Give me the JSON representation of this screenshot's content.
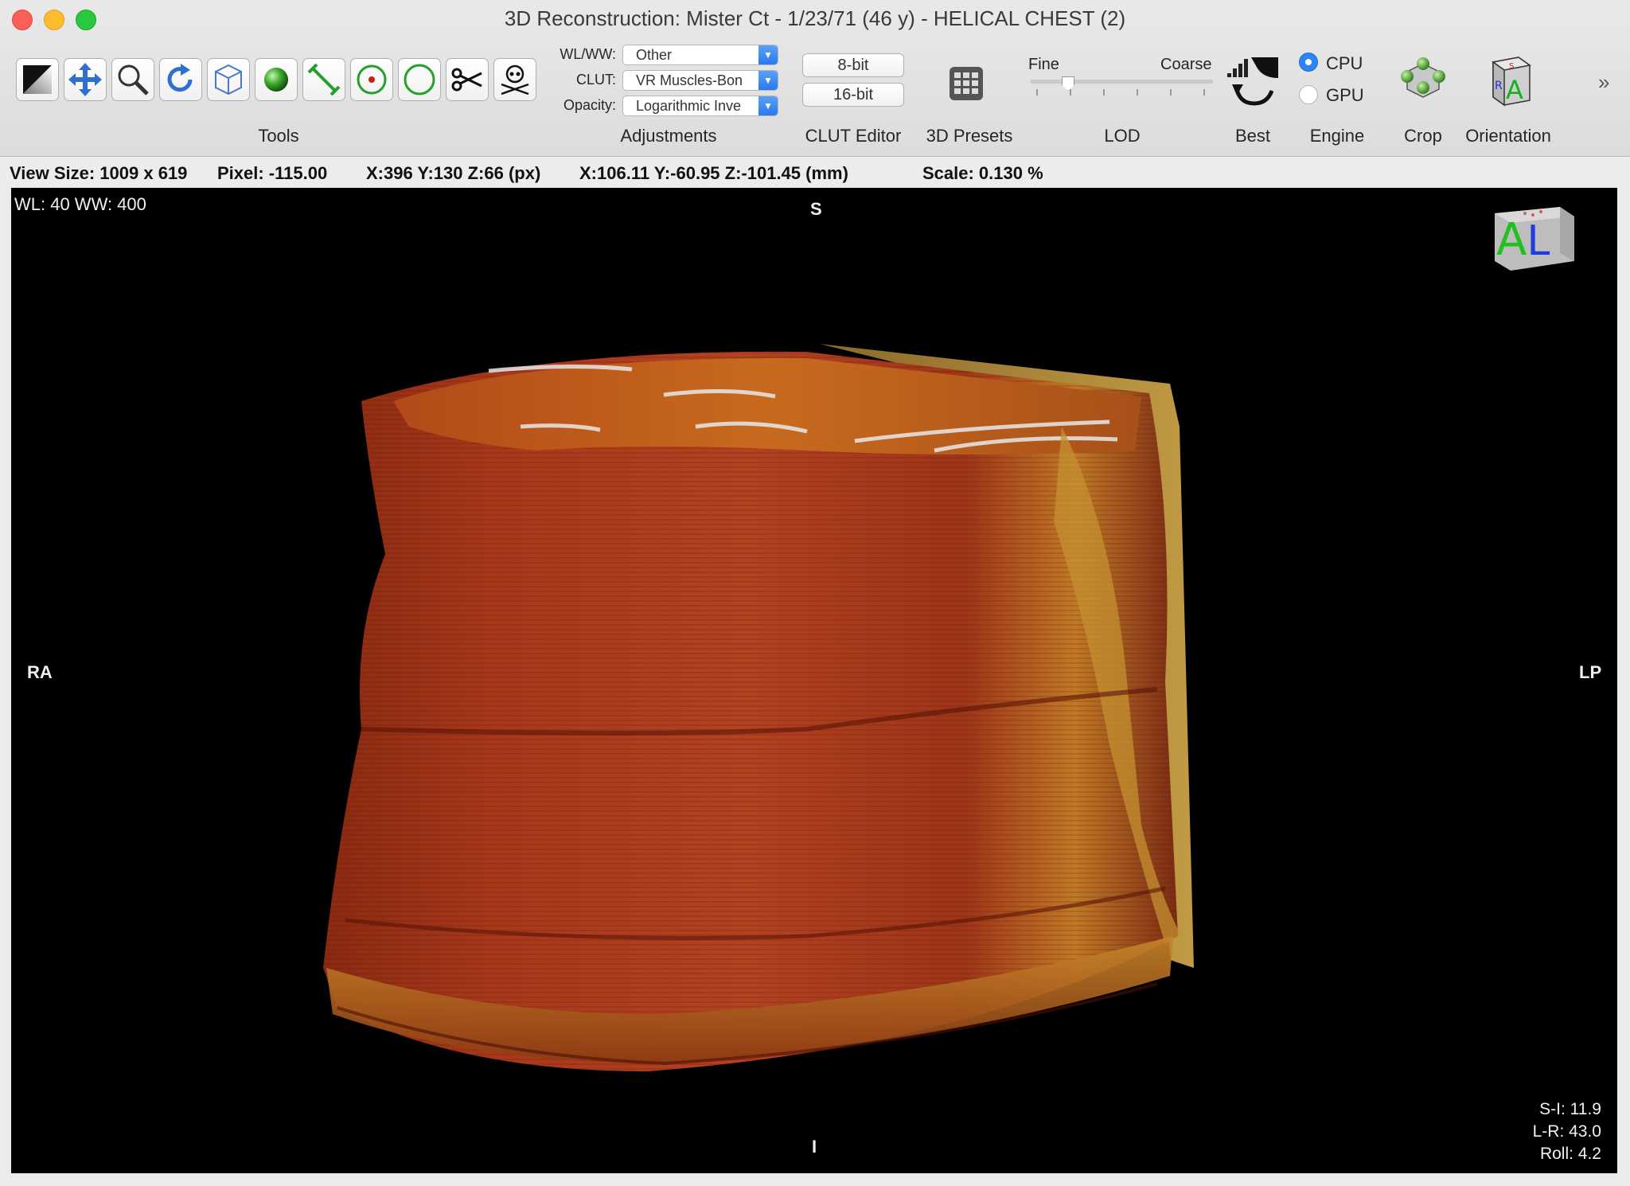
{
  "window": {
    "title": "3D Reconstruction: Mister Ct - 1/23/71 (46 y) - HELICAL CHEST (2)"
  },
  "toolbar": {
    "tools": [
      {
        "name": "wl-ww-tool",
        "icon": "contrast-icon"
      },
      {
        "name": "move-tool",
        "icon": "move-arrows-icon"
      },
      {
        "name": "zoom-tool",
        "icon": "magnifier-icon"
      },
      {
        "name": "rotate-tool",
        "icon": "rotate-icon"
      },
      {
        "name": "3d-rotate-tool",
        "icon": "cube-icon"
      },
      {
        "name": "sphere-tool",
        "icon": "green-sphere-icon"
      },
      {
        "name": "length-tool",
        "icon": "measure-line-icon"
      },
      {
        "name": "point-tool",
        "icon": "point-target-icon"
      },
      {
        "name": "oval-tool",
        "icon": "circle-icon"
      },
      {
        "name": "scissors-tool",
        "icon": "scissors-icon"
      },
      {
        "name": "bone-removal-tool",
        "icon": "skull-crossbones-icon"
      }
    ],
    "tools_label": "Tools",
    "adjustments": {
      "wlww_label": "WL/WW:",
      "wlww_value": "Other",
      "clut_label": "CLUT:",
      "clut_value": "VR Muscles-Bon",
      "opacity_label": "Opacity:",
      "opacity_value": "Logarithmic Inve",
      "group_label": "Adjustments"
    },
    "clut_editor": {
      "bit8": "8-bit",
      "bit16": "16-bit",
      "group_label": "CLUT Editor"
    },
    "presets_label": "3D Presets",
    "lod": {
      "fine": "Fine",
      "coarse": "Coarse",
      "group_label": "LOD",
      "level": 0.2
    },
    "best_label": "Best",
    "engine": {
      "cpu": "CPU",
      "gpu": "GPU",
      "selected": "CPU",
      "group_label": "Engine"
    },
    "crop_label": "Crop",
    "orientation_label": "Orientation",
    "more": "»"
  },
  "infobar": {
    "view_size": "View Size: 1009 x 619",
    "pixel": "Pixel: -115.00",
    "coords_px": "X:396 Y:130 Z:66 (px)",
    "coords_mm": "X:106.11 Y:-60.95 Z:-101.45 (mm)",
    "scale": "Scale: 0.130 %"
  },
  "viewport": {
    "wl_ww": "WL: 40 WW: 400",
    "top": "S",
    "bottom": "I",
    "left": "RA",
    "right": "LP",
    "cube_letters": "AL",
    "si": "S-I: 11.9",
    "lr": "L-R: 43.0",
    "roll": "Roll: 4.2"
  },
  "colors": {
    "accent": "#2d85f3",
    "tissue_dark": "#6e1a10",
    "tissue_mid": "#b8401c",
    "tissue_fat": "#c79a2e"
  }
}
